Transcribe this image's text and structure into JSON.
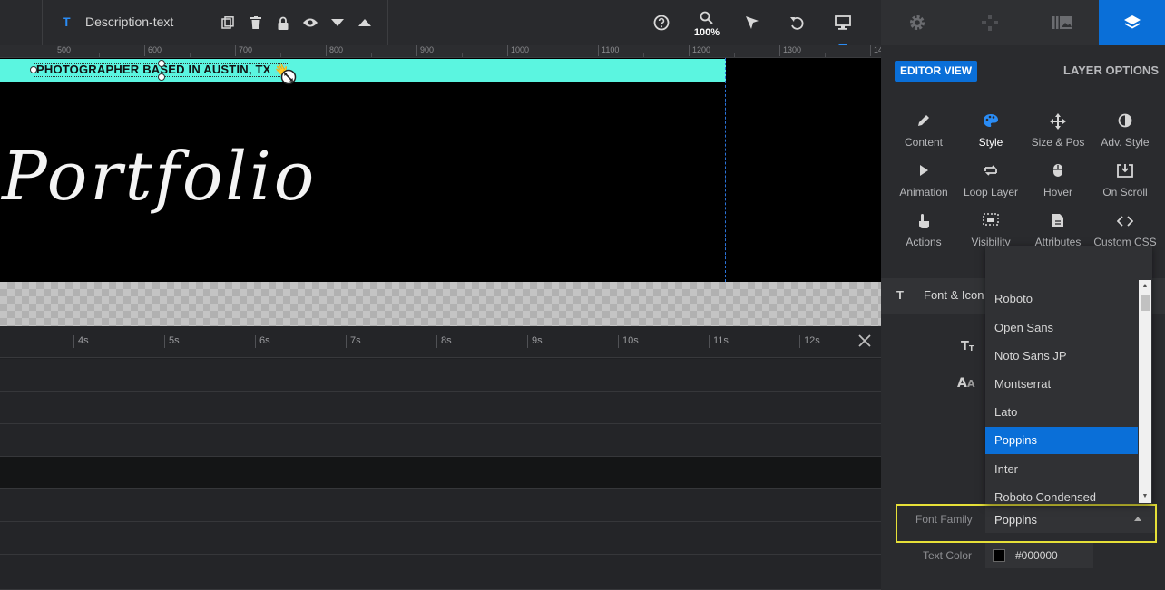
{
  "toolbar": {
    "layer_type_icon": "T",
    "layer_name": "Description-text",
    "zoom": "100%"
  },
  "ruler": {
    "ticks": [
      "500",
      "600",
      "700",
      "800",
      "900",
      "1000",
      "1100",
      "1200",
      "1300",
      "14"
    ]
  },
  "canvas": {
    "banner_text": "PHOTOGRAPHER BASED IN AUSTIN, TX",
    "banner_emoji": "👋",
    "title_text": "Portfolio",
    "banner_color": "#5bf5e0"
  },
  "timeline": {
    "marks": [
      "4s",
      "5s",
      "6s",
      "7s",
      "8s",
      "9s",
      "10s",
      "11s",
      "12s"
    ]
  },
  "panel": {
    "editor_view_label": "EDITOR VIEW",
    "layer_options_label": "LAYER OPTIONS",
    "style_tabs": [
      {
        "label": "Content",
        "icon": "pencil-icon"
      },
      {
        "label": "Style",
        "icon": "palette-icon"
      },
      {
        "label": "Size & Pos",
        "icon": "move-icon"
      },
      {
        "label": "Adv. Style",
        "icon": "contrast-icon"
      },
      {
        "label": "Animation",
        "icon": "play-icon"
      },
      {
        "label": "Loop Layer",
        "icon": "loop-icon"
      },
      {
        "label": "Hover",
        "icon": "mouse-icon"
      },
      {
        "label": "On Scroll",
        "icon": "scroll-download-icon"
      },
      {
        "label": "Actions",
        "icon": "hand-pointer-icon"
      },
      {
        "label": "Visibility",
        "icon": "visibility-icon"
      },
      {
        "label": "Attributes",
        "icon": "document-icon"
      },
      {
        "label": "Custom CSS",
        "icon": "code-icon"
      }
    ],
    "section_title": "Font & Icon",
    "font_family_label": "Font Family",
    "font_family_value": "Poppins",
    "text_color_label": "Text Color",
    "text_color_value": "#000000",
    "accent_color": "#0a6fd8"
  },
  "font_dropdown": {
    "options": [
      "Roboto",
      "Open Sans",
      "Noto Sans JP",
      "Montserrat",
      "Lato",
      "Poppins",
      "Inter",
      "Roboto Condensed"
    ],
    "selected": "Poppins"
  }
}
